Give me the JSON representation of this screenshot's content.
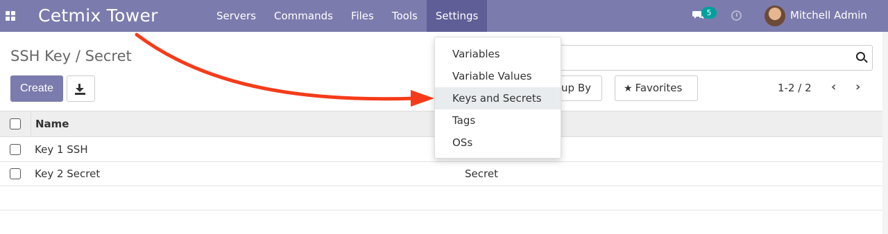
{
  "navbar": {
    "brand": "Cetmix Tower",
    "menu": [
      {
        "label": "Servers"
      },
      {
        "label": "Commands"
      },
      {
        "label": "Files"
      },
      {
        "label": "Tools"
      },
      {
        "label": "Settings",
        "active": true
      }
    ],
    "chat_count": "5",
    "user_name": "Mitchell Admin",
    "brand_color": "#7c7bad"
  },
  "control_panel": {
    "breadcrumb": "SSH Key / Secret",
    "create_label": "Create",
    "group_by_label": "up By",
    "favorites_label": "Favorites",
    "pager_text": "1-2 / 2",
    "pager_prev": "‹",
    "pager_next": "›"
  },
  "list": {
    "columns": [
      "Name"
    ],
    "rows": [
      {
        "name": "Key 1 SSH",
        "type": ""
      },
      {
        "name": "Key 2 Secret",
        "type": "Secret"
      }
    ]
  },
  "settings_menu": {
    "items": [
      {
        "label": "Variables"
      },
      {
        "label": "Variable Values"
      },
      {
        "label": "Keys and Secrets",
        "selected": true
      },
      {
        "label": "Tags"
      },
      {
        "label": "OSs"
      }
    ]
  },
  "annotation": {
    "arrow_color": "#f53b1a"
  }
}
